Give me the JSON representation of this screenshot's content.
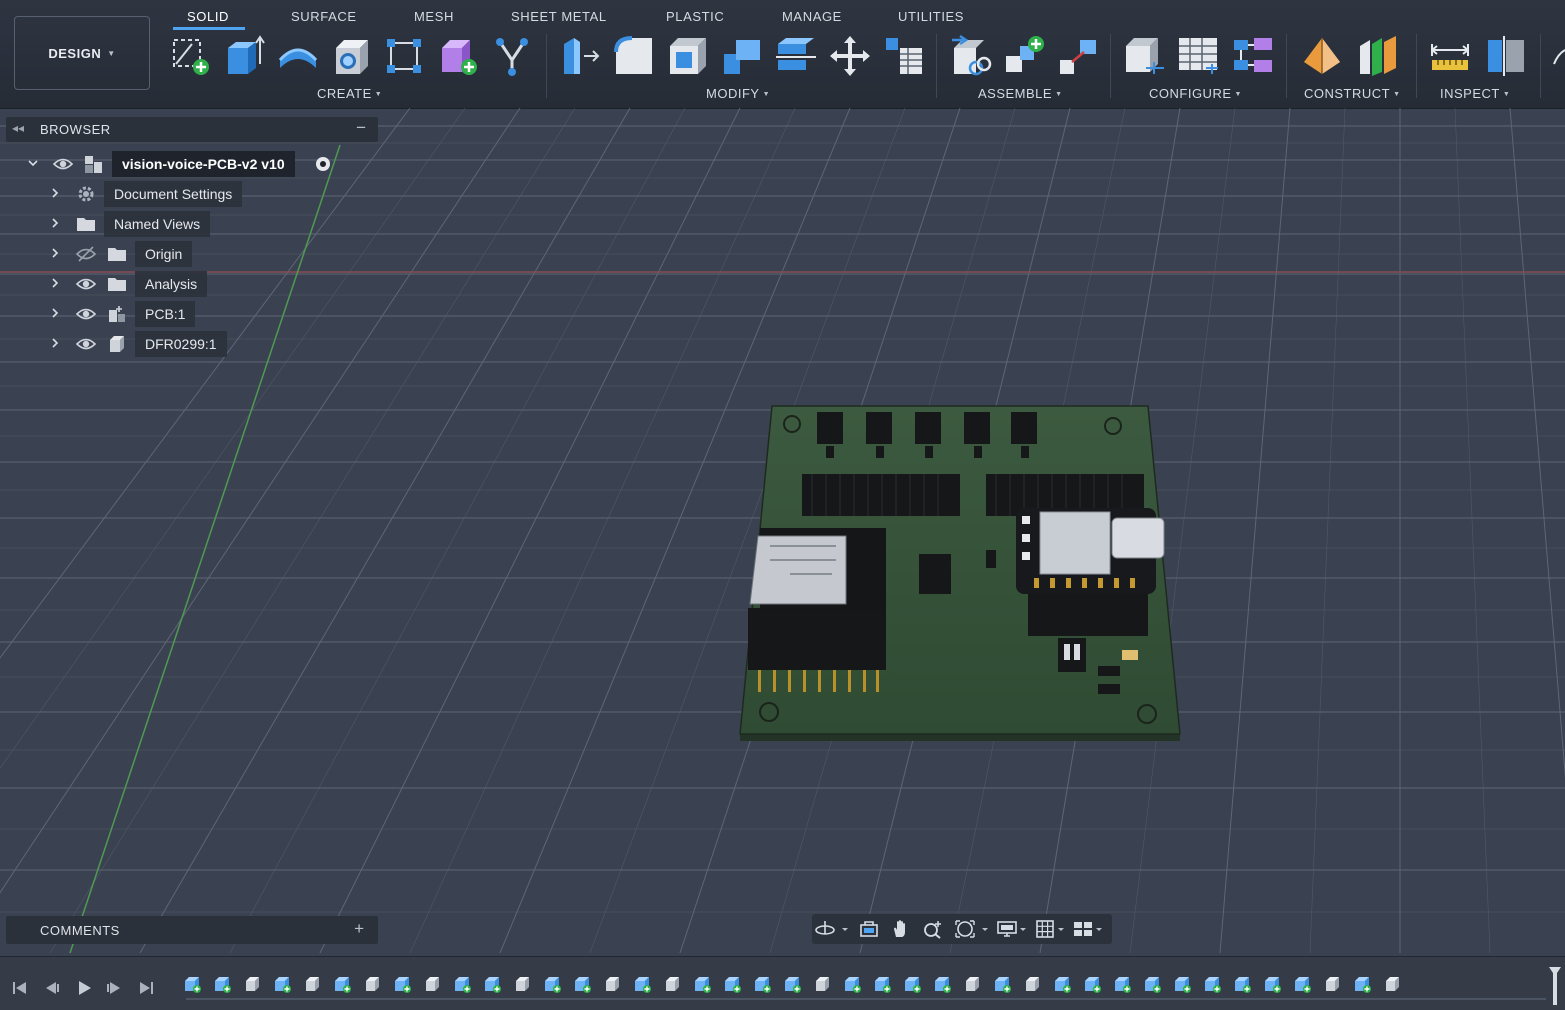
{
  "workspace": {
    "label": "DESIGN"
  },
  "tabs": [
    {
      "label": "SOLID",
      "active": true
    },
    {
      "label": "SURFACE"
    },
    {
      "label": "MESH"
    },
    {
      "label": "SHEET METAL"
    },
    {
      "label": "PLASTIC"
    },
    {
      "label": "MANAGE"
    },
    {
      "label": "UTILITIES"
    }
  ],
  "groups": {
    "create": "CREATE",
    "modify": "MODIFY",
    "assemble": "ASSEMBLE",
    "configure": "CONFIGURE",
    "construct": "CONSTRUCT",
    "inspect": "INSPECT"
  },
  "browser": {
    "title": "BROWSER",
    "root": "vision-voice-PCB-v2 v10",
    "items": [
      {
        "label": "Document Settings",
        "icon": "gear-icon"
      },
      {
        "label": "Named Views",
        "icon": "folder-icon"
      },
      {
        "label": "Origin",
        "icon": "folder-icon",
        "visibility": "hidden"
      },
      {
        "label": "Analysis",
        "icon": "folder-icon",
        "visibility": "visible"
      },
      {
        "label": "PCB:1",
        "icon": "component-icon",
        "visibility": "visible"
      },
      {
        "label": "DFR0299:1",
        "icon": "body-icon",
        "visibility": "visible"
      }
    ]
  },
  "comments": {
    "title": "COMMENTS"
  },
  "colors": {
    "accent": "#4ea4f0",
    "background": "#3a4251",
    "pcb": "#3f5a40",
    "origin_x_axis": "#8a4a52",
    "origin_y_axis": "#4f9a52"
  }
}
